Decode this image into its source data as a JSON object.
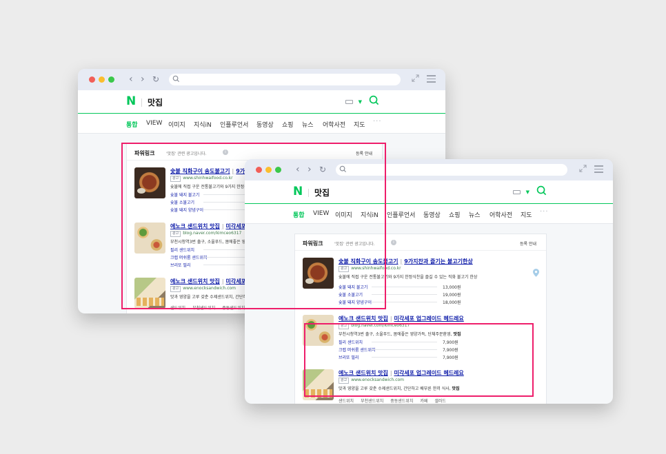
{
  "colors": {
    "background": "#ececec",
    "naver_green": "#03c75a",
    "highlight": "#ee1d6a",
    "ad_title": "#0c1aa8",
    "ad_url": "#3c7a48"
  },
  "browser": {
    "logo": "N",
    "query": "맛집",
    "tabs": [
      "통합",
      "VIEW",
      "이미지",
      "지식iN",
      "인플루언서",
      "동영상",
      "쇼핑",
      "뉴스",
      "어학사전",
      "지도",
      "···"
    ],
    "active_tab": "통합"
  },
  "powerlink": {
    "title": "파워링크",
    "subtitle": "'맛집' 관련 광고입니다.",
    "register": "등록 안내",
    "ads": [
      {
        "title": "숯불 직화구이 송도불고기",
        "title2": "9가지찬과 즐기는 불고기한상",
        "badge": "광고",
        "url": "www.shinhwaifood.co.kr",
        "desc": "숯불에 직접 구운 전통불고기와 9가지 한정식찬을 즐길 수 있는 직화 불고기 한상",
        "sublinks": [
          {
            "label": "숯불 돼지 불고기",
            "price": "13,000원"
          },
          {
            "label": "숯불 소불고기",
            "price": "19,000원"
          },
          {
            "label": "숯불 돼지 양념구이",
            "price": "18,000원"
          }
        ]
      },
      {
        "title": "에노크 샌드위치 맛집",
        "title2": "미각세포 업그레이드 헤드레요",
        "badge": "광고",
        "url": "blog.naver.com/kimceo6317",
        "desc": "부천시청역3번 출구, 소울푸드, 몸에좋은 영양가득, 단체주문환영,",
        "desc_bold": "맛집",
        "sublinks": [
          {
            "label": "필리 샌드위치",
            "price": "7,900원"
          },
          {
            "label": "크랩 머쉬룸 샌드위치",
            "price": "7,900원"
          },
          {
            "label": "브리또 필리",
            "price": "7,900원"
          }
        ]
      },
      {
        "title": "에노크 샌드위치 맛집",
        "title2": "미각세포 업그레이드 헤드레요",
        "badge": "광고",
        "url": "www.enocksandwich.com",
        "desc": "맛과 영양을 고루 갖춘 수제샌드위치, 간단하고 배부른 한끼 식사,",
        "desc_bold": "맛집",
        "tags": [
          "샌드위치",
          "부천샌드위치",
          "중동샌드위치",
          "카페",
          "샐러드"
        ]
      }
    ]
  }
}
